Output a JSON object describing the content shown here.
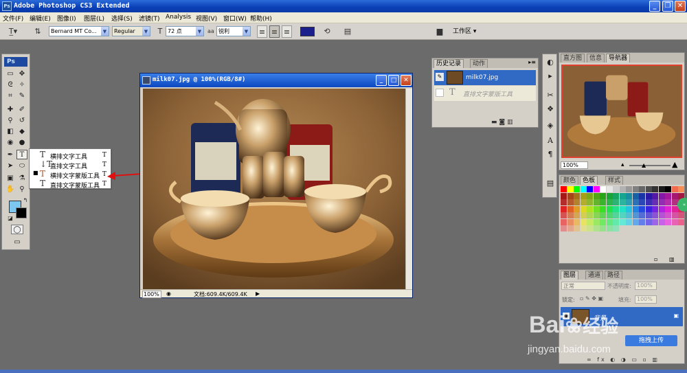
{
  "window": {
    "title": "Adobe Photoshop CS3 Extended",
    "app_icon": "Ps",
    "minimize": "_",
    "maximize": "❐",
    "close": "✕"
  },
  "menu": [
    "文件(F)",
    "编辑(E)",
    "图像(I)",
    "图层(L)",
    "选择(S)",
    "滤镜(T)",
    "Analysis",
    "视图(V)",
    "窗口(W)",
    "帮助(H)"
  ],
  "options_bar": {
    "font_family": "Bernard MT Co...",
    "font_style": "Regular",
    "font_size": "72 点",
    "antialias_label": "aa",
    "antialias": "锐利",
    "workspace": "工作区 ▾",
    "text_color": "#1a1f8c"
  },
  "toolbox": {
    "badge": "Ps",
    "fg_color": "#7cc6f0",
    "bg_color": "#000000"
  },
  "type_flyout": {
    "items": [
      {
        "label": "横排文字工具",
        "shortcut": "T",
        "active": false
      },
      {
        "label": "直排文字工具",
        "shortcut": "T",
        "active": false
      },
      {
        "label": "横排文字蒙版工具",
        "shortcut": "T",
        "active": true
      },
      {
        "label": "直排文字蒙版工具",
        "shortcut": "T",
        "active": false
      }
    ],
    "bullet": "■"
  },
  "document": {
    "title": "milk07.jpg @ 100%(RGB/8#)",
    "zoom": "100%",
    "doc_info": "文档:609.4K/609.4K",
    "expand_arrow": "▶"
  },
  "history_panel": {
    "tabs": [
      "历史记录",
      "动作"
    ],
    "snapshot_name": "milk07.jpg",
    "step_label": "直排文字蒙版工具"
  },
  "navigator_panel": {
    "tabs": [
      "直方图",
      "信息",
      "导航器"
    ],
    "zoom": "100%"
  },
  "swatches_panel": {
    "tabs": [
      "颜色",
      "色板",
      "样式"
    ]
  },
  "layers_panel": {
    "tabs": [
      "图层",
      "通道",
      "路径"
    ],
    "blend_mode": "正常",
    "opacity_label": "不透明度:",
    "opacity": "100%",
    "lock_label": "锁定:",
    "fill_label": "填充:",
    "fill": "100%",
    "layer_name": "背景"
  },
  "watermark": {
    "brand_a": "Bai",
    "brand_b": "经验",
    "url": "jingyan.baidu.com",
    "upload_button": "拖拽上传"
  }
}
